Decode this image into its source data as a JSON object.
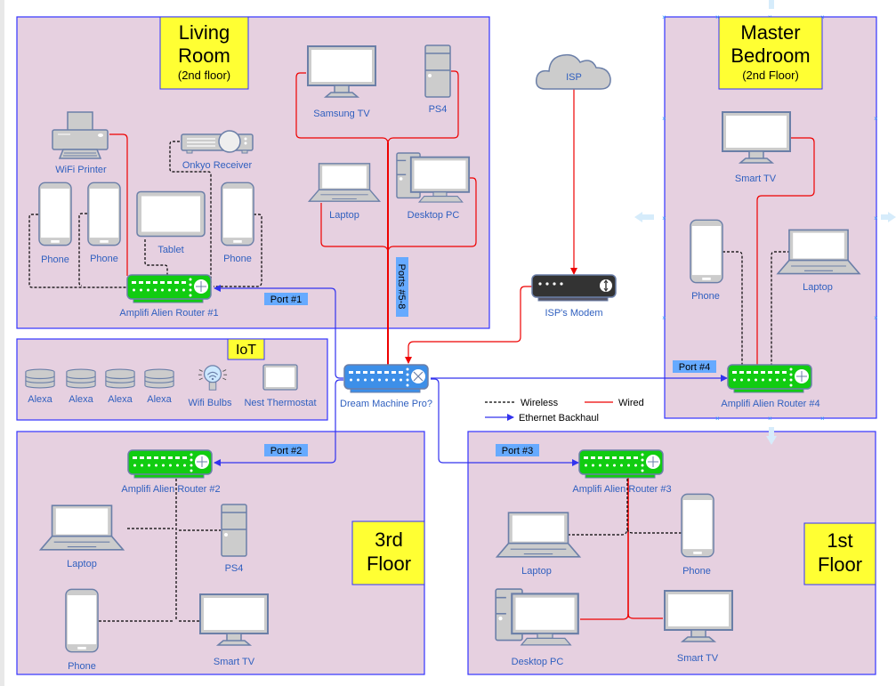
{
  "colors": {
    "room_fill": "#e6d0e0",
    "room_border": "#3333ff",
    "title_fill": "#ffff33",
    "wired": "#ee0000",
    "wireless": "#000000",
    "backhaul": "#3333ee",
    "router_green": "#11cc11",
    "router_blue": "#3d8fe8",
    "modem_dark": "#333333",
    "device_gray": "#cccccc",
    "device_stroke": "#6b7fa8",
    "port_label_fill": "#66aaff",
    "label_text": "#2f5fbf"
  },
  "rooms": {
    "living_room": {
      "title_line1": "Living",
      "title_line2": "Room",
      "subtitle": "(2nd floor)"
    },
    "master_bedroom": {
      "title_line1": "Master",
      "title_line2": "Bedroom",
      "subtitle": "(2nd Floor)"
    },
    "iot": {
      "title": "IoT"
    },
    "third_floor": {
      "title_line1": "3rd",
      "title_line2": "Floor"
    },
    "first_floor": {
      "title_line1": "1st",
      "title_line2": "Floor"
    }
  },
  "devices": {
    "living_room": {
      "wifi_printer": "WiFi Printer",
      "onkyo_receiver": "Onkyo Receiver",
      "samsung_tv": "Samsung TV",
      "ps4": "PS4",
      "laptop": "Laptop",
      "desktop_pc": "Desktop PC",
      "phone_1": "Phone",
      "phone_2": "Phone",
      "tablet": "Tablet",
      "phone_3": "Phone",
      "router": "Amplifi Alien Router #1"
    },
    "iot": {
      "alexa_1": "Alexa",
      "alexa_2": "Alexa",
      "alexa_3": "Alexa",
      "alexa_4": "Alexa",
      "wifi_bulbs": "Wifi Bulbs",
      "nest_thermostat": "Nest Thermostat"
    },
    "core": {
      "isp": "ISP",
      "modem": "ISP's Modem",
      "dream_machine": "Dream Machine Pro?"
    },
    "master_bedroom": {
      "smart_tv": "Smart TV",
      "phone": "Phone",
      "laptop": "Laptop",
      "router": "Amplifi Alien Router #4"
    },
    "third_floor": {
      "router": "Amplifi Alien Router #2",
      "laptop": "Laptop",
      "ps4": "PS4",
      "phone": "Phone",
      "smart_tv": "Smart TV"
    },
    "first_floor": {
      "router": "Amplifi Alien Router #3",
      "laptop": "Laptop",
      "phone": "Phone",
      "desktop_pc": "Desktop PC",
      "smart_tv": "Smart TV"
    }
  },
  "ports": {
    "port1": "Port #1",
    "port2": "Port #2",
    "port3": "Port #3",
    "port4": "Port #4",
    "ports5_8": "Ports #5-8"
  },
  "legend": {
    "wireless": "Wireless",
    "wired": "Wired",
    "backhaul": "Ethernet Backhaul"
  }
}
